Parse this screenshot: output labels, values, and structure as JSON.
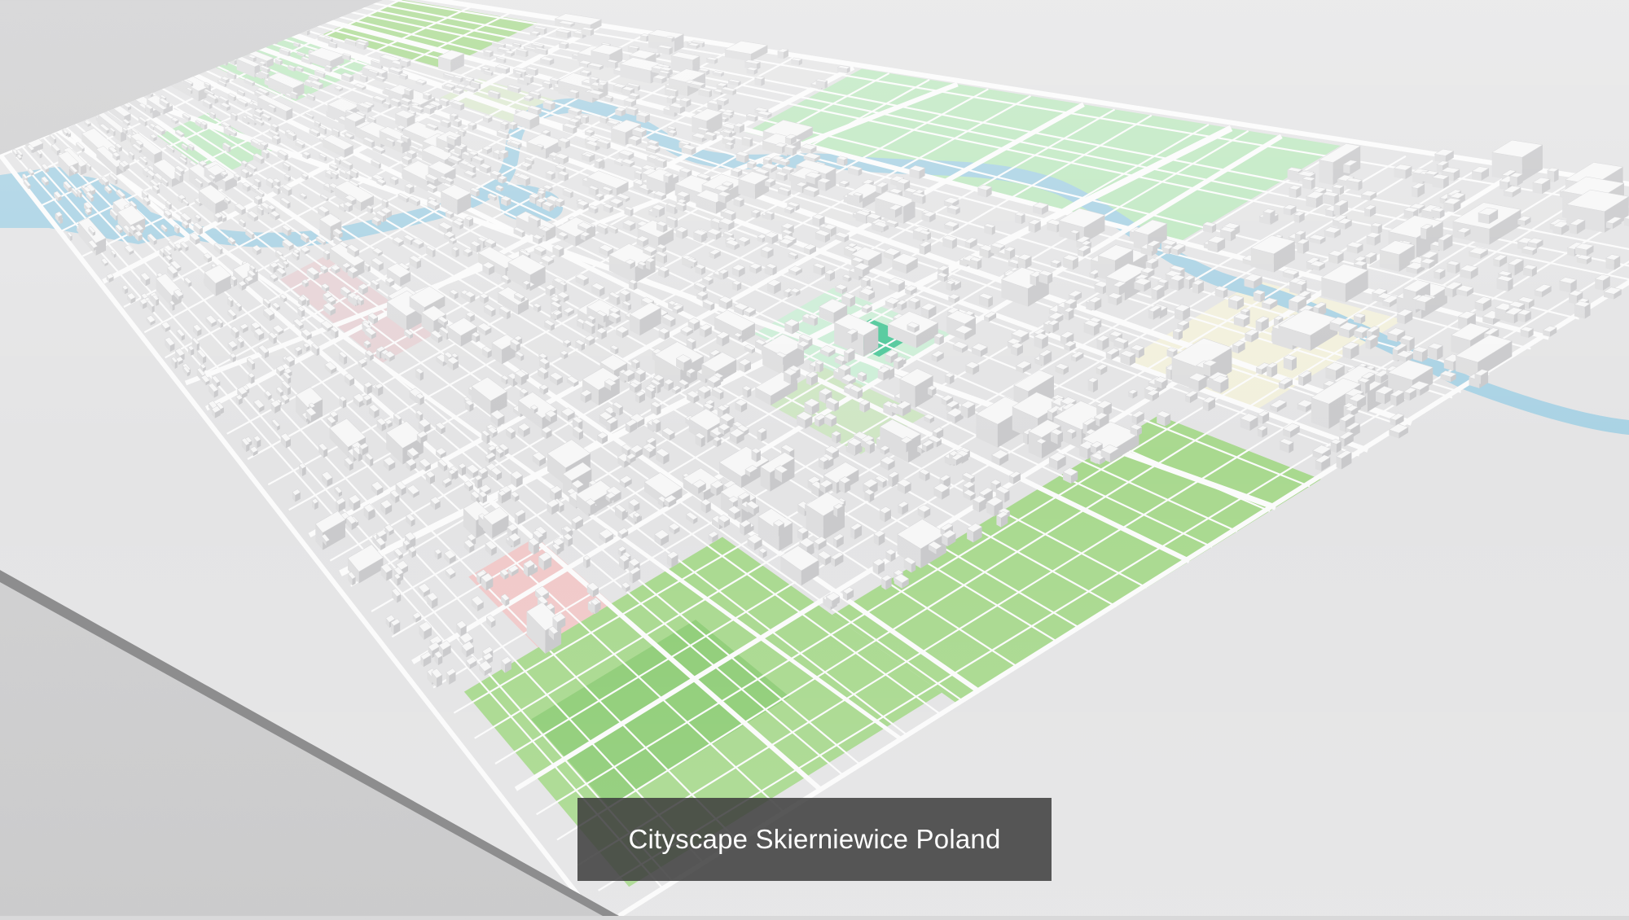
{
  "caption": {
    "text": "Cityscape Skierniewice Poland"
  },
  "map": {
    "type": "3d-isometric-city-model",
    "colors": {
      "ground": "#e6e6e6",
      "block": "#d6d6d8",
      "building_top": "#f7f7f7",
      "building_side": "#c9c9cb",
      "road": "#fbfbfb",
      "water": "#a9d2e4",
      "park": "#bfe8c1",
      "field": "#a9d98f",
      "sports": "#4fc89a",
      "industrial_pink": "#e7d3d6",
      "background": "#d6d6d7"
    }
  }
}
